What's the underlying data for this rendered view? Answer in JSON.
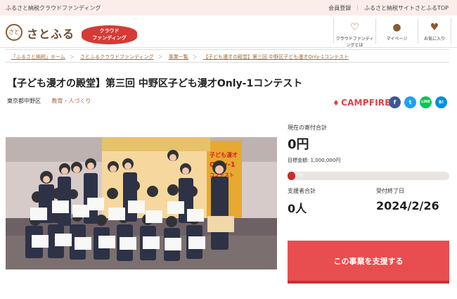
{
  "topbar": {
    "tagline": "ふるさと納税クラウドファンディング",
    "links": [
      "会員登録",
      "ふるさと納税サイトさとふるTOP"
    ]
  },
  "header": {
    "logo_mark": "さと",
    "logo_text": "さとふる",
    "badge": [
      "クラウド",
      "ファンディング"
    ],
    "nav": [
      {
        "label": "クラウドファンディングとは",
        "icon": "cloud-heart-icon"
      },
      {
        "label": "マイページ",
        "icon": "person-icon"
      },
      {
        "label": "お気に入り",
        "icon": "heart-icon"
      }
    ]
  },
  "breadcrumb": [
    "「ふるさと納税」ホーム",
    "さとふるクラウドファンディング",
    "事業一覧",
    "【子ども漫才の殿堂】第三回 中野区子ども漫才Only-1コンテスト"
  ],
  "project": {
    "title": "【子ども漫才の殿堂】第三回 中野区子ども漫才Only-1コンテスト",
    "region": "東京都中野区",
    "category": "教育・人づくり",
    "platform": "CAMPFIRE",
    "share_buttons": [
      "f",
      "t",
      "LINE",
      "B!"
    ]
  },
  "photo": {
    "banner_lines": [
      "子ども漫才",
      "Only-1",
      "コンテスト"
    ]
  },
  "funding": {
    "current_label": "現在の寄付合計",
    "current_amount": "0円",
    "goal_text": "目標金額: 1,000,000円",
    "progress_percent": 0,
    "progress_label": "0%",
    "supporters_label": "支援者合計",
    "supporters_value": "0人",
    "deadline_label": "受付終了日",
    "deadline_value": "2024/2/26",
    "button_label": "この事業を支援する"
  },
  "colors": {
    "accent": "#E84E4F",
    "brand_brown": "#8A5A32",
    "topbar_bg": "#FBEEEA"
  }
}
